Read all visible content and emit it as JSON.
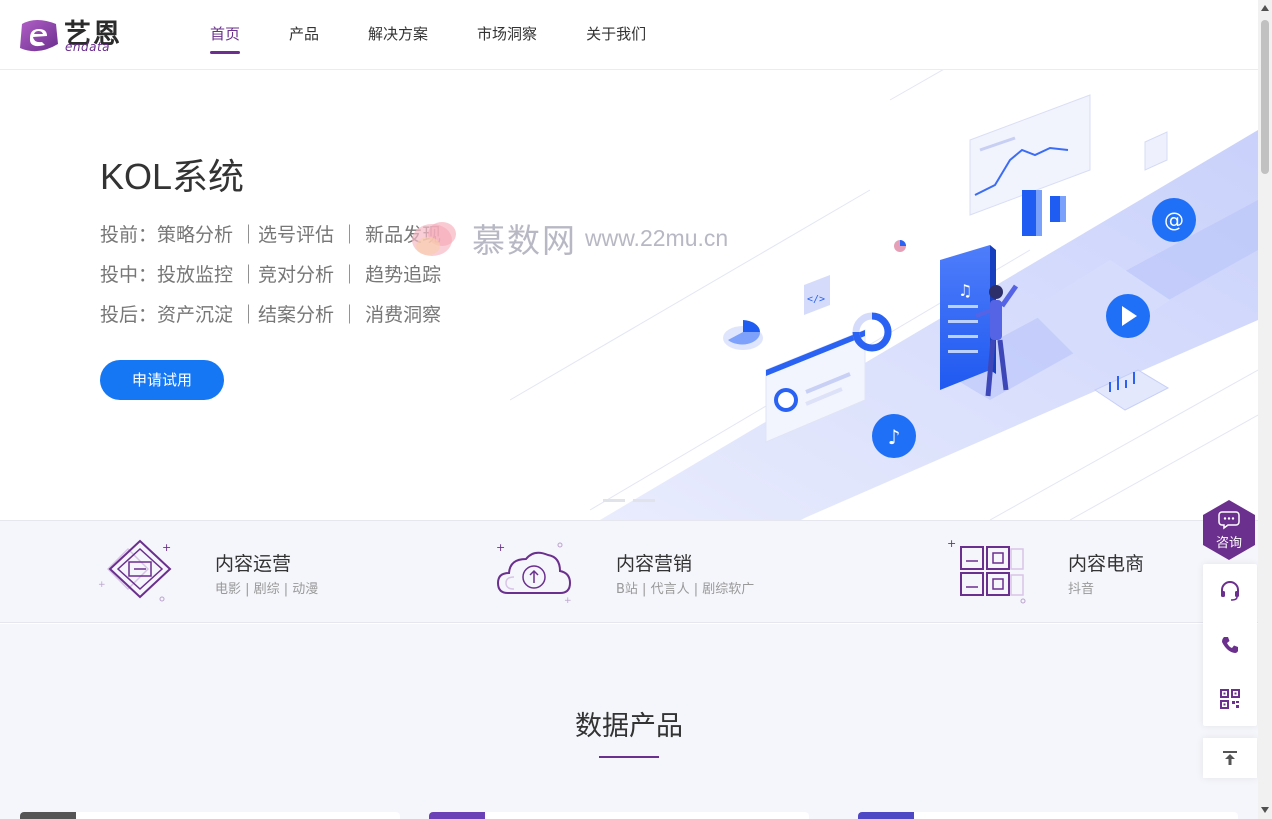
{
  "logo": {
    "cn": "艺恩",
    "en": "endata"
  },
  "nav": {
    "items": [
      "首页",
      "产品",
      "解决方案",
      "市场洞察",
      "关于我们"
    ],
    "active": "首页"
  },
  "hero": {
    "title": "KOL系统",
    "lines": [
      "投前：策略分析 ｜选号评估 ｜ 新品发现",
      "投中：投放监控 ｜竞对分析 ｜ 趋势追踪",
      "投后：资产沉淀 ｜结案分析 ｜ 消费洞察"
    ],
    "button": "申请试用"
  },
  "watermark": {
    "cn": "慕数网",
    "url": "www.22mu.cn"
  },
  "categories": [
    {
      "title": "内容运营",
      "sub": "电影 | 剧综 | 动漫",
      "icon": "screen-diamond-icon"
    },
    {
      "title": "内容营销",
      "sub": "B站 | 代言人 | 剧综软广",
      "icon": "cloud-upload-icon"
    },
    {
      "title": "内容电商",
      "sub": "抖音",
      "icon": "grid-squares-icon"
    }
  ],
  "section": {
    "title": "数据产品"
  },
  "float": {
    "consult": "咨询",
    "icons": [
      "headset-icon",
      "phone-icon",
      "qrcode-icon"
    ],
    "top": "back-to-top-icon"
  },
  "colors": {
    "brand": "#6b2f8e",
    "accent": "#1677f5",
    "text": "#333333"
  }
}
